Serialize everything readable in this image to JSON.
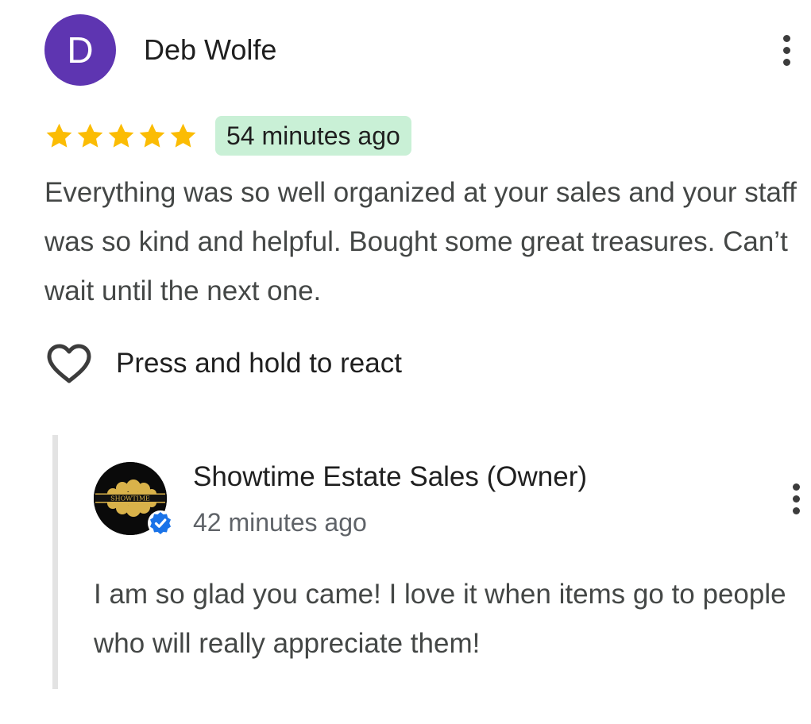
{
  "review": {
    "reviewer": {
      "initial": "D",
      "name": "Deb Wolfe",
      "avatar_color": "#5e35b1"
    },
    "rating": 5,
    "rating_max": 5,
    "star_color": "#fbbc04",
    "time": "54 minutes ago",
    "time_badge_color": "#c9f0d6",
    "text": "Everything was so well organized at your sales and your staff was so kind and helpful. Bought some great treasures. Can’t wait until the next one.",
    "react_label": "Press and hold to react",
    "more_icon": "more-vert-icon"
  },
  "reply": {
    "owner_name": "Showtime Estate Sales (Owner)",
    "logo_text": "SHOWTIME",
    "time": "42 minutes ago",
    "text": "I am so glad you came! I love it when items go to people who will really appreciate them!",
    "verified_color": "#1a73e8",
    "more_icon": "more-vert-icon"
  }
}
